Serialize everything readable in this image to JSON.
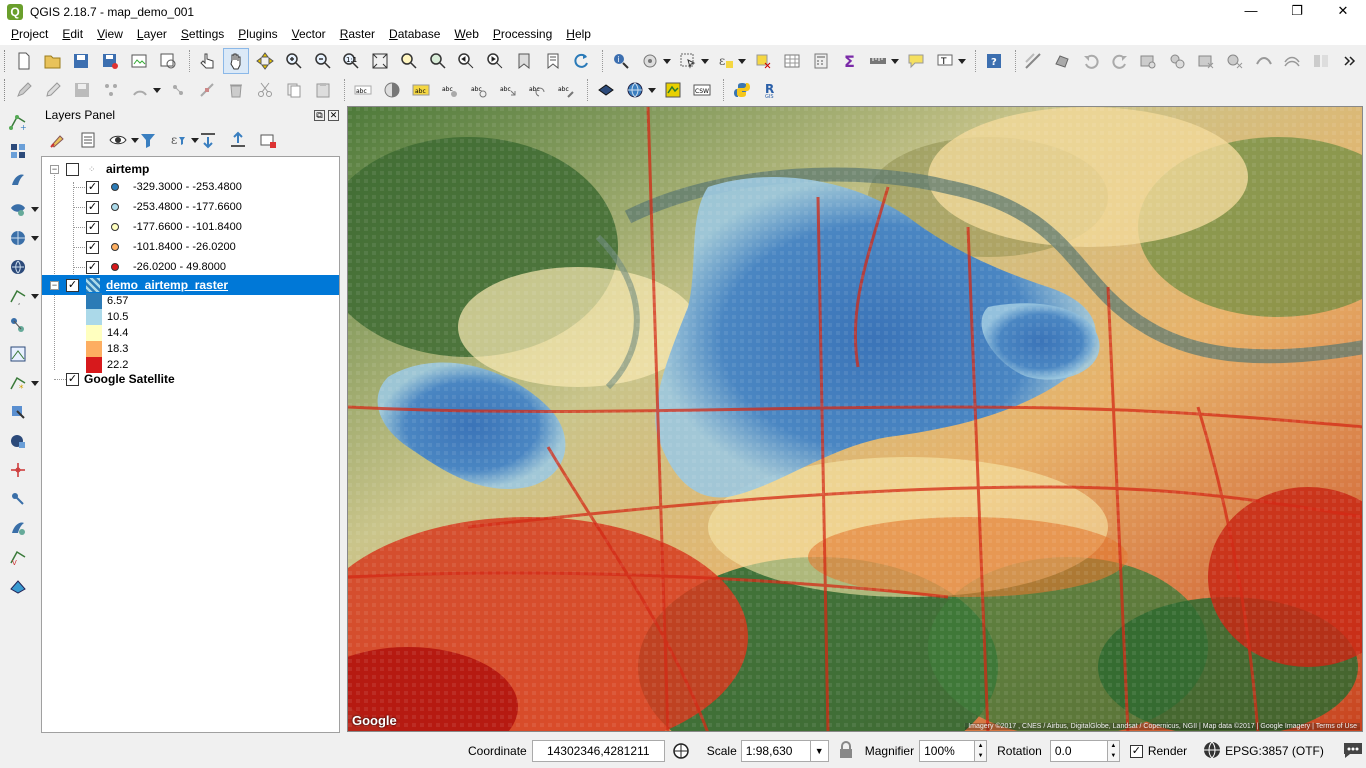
{
  "window": {
    "title": "QGIS 2.18.7 - map_demo_001",
    "logo_letter": "Q"
  },
  "menu": [
    "Project",
    "Edit",
    "View",
    "Layer",
    "Settings",
    "Plugins",
    "Vector",
    "Raster",
    "Database",
    "Web",
    "Processing",
    "Help"
  ],
  "layers_panel": {
    "title": "Layers Panel",
    "layers": [
      {
        "name": "airtemp",
        "checked": false,
        "classes": [
          {
            "label": "-329.3000 - -253.4800",
            "color": "#2c7bb6",
            "checked": true
          },
          {
            "label": "-253.4800 - -177.6600",
            "color": "#abd9e9",
            "checked": true
          },
          {
            "label": "-177.6600 - -101.8400",
            "color": "#ffffbf",
            "checked": true
          },
          {
            "label": "-101.8400 - -26.0200",
            "color": "#fdae61",
            "checked": true
          },
          {
            "label": "-26.0200 - 49.8000",
            "color": "#d7191c",
            "checked": true
          }
        ]
      },
      {
        "name": "demo_airtemp_raster",
        "checked": true,
        "selected": true,
        "classes": [
          {
            "label": "6.57",
            "color": "#2c7bb6"
          },
          {
            "label": "10.5",
            "color": "#abd9e9"
          },
          {
            "label": "14.4",
            "color": "#ffffbf"
          },
          {
            "label": "18.3",
            "color": "#fdae61"
          },
          {
            "label": "22.2",
            "color": "#d7191c"
          }
        ]
      },
      {
        "name": "Google Satellite",
        "checked": true
      }
    ]
  },
  "map": {
    "watermark": "Google",
    "attribution": "Imagery ©2017 , CNES / Airbus, DigitalGlobe, Landsat / Copernicus, NGII | Map data ©2017 | Google Imagery | Terms of Use"
  },
  "status": {
    "coordinate_label": "Coordinate",
    "coordinate_value": "14302346,4281211",
    "scale_label": "Scale",
    "scale_value": "1:98,630",
    "magnifier_label": "Magnifier",
    "magnifier_value": "100%",
    "rotation_label": "Rotation",
    "rotation_value": "0.0",
    "render_label": "Render",
    "render_checked": true,
    "crs": "EPSG:3857 (OTF)"
  }
}
